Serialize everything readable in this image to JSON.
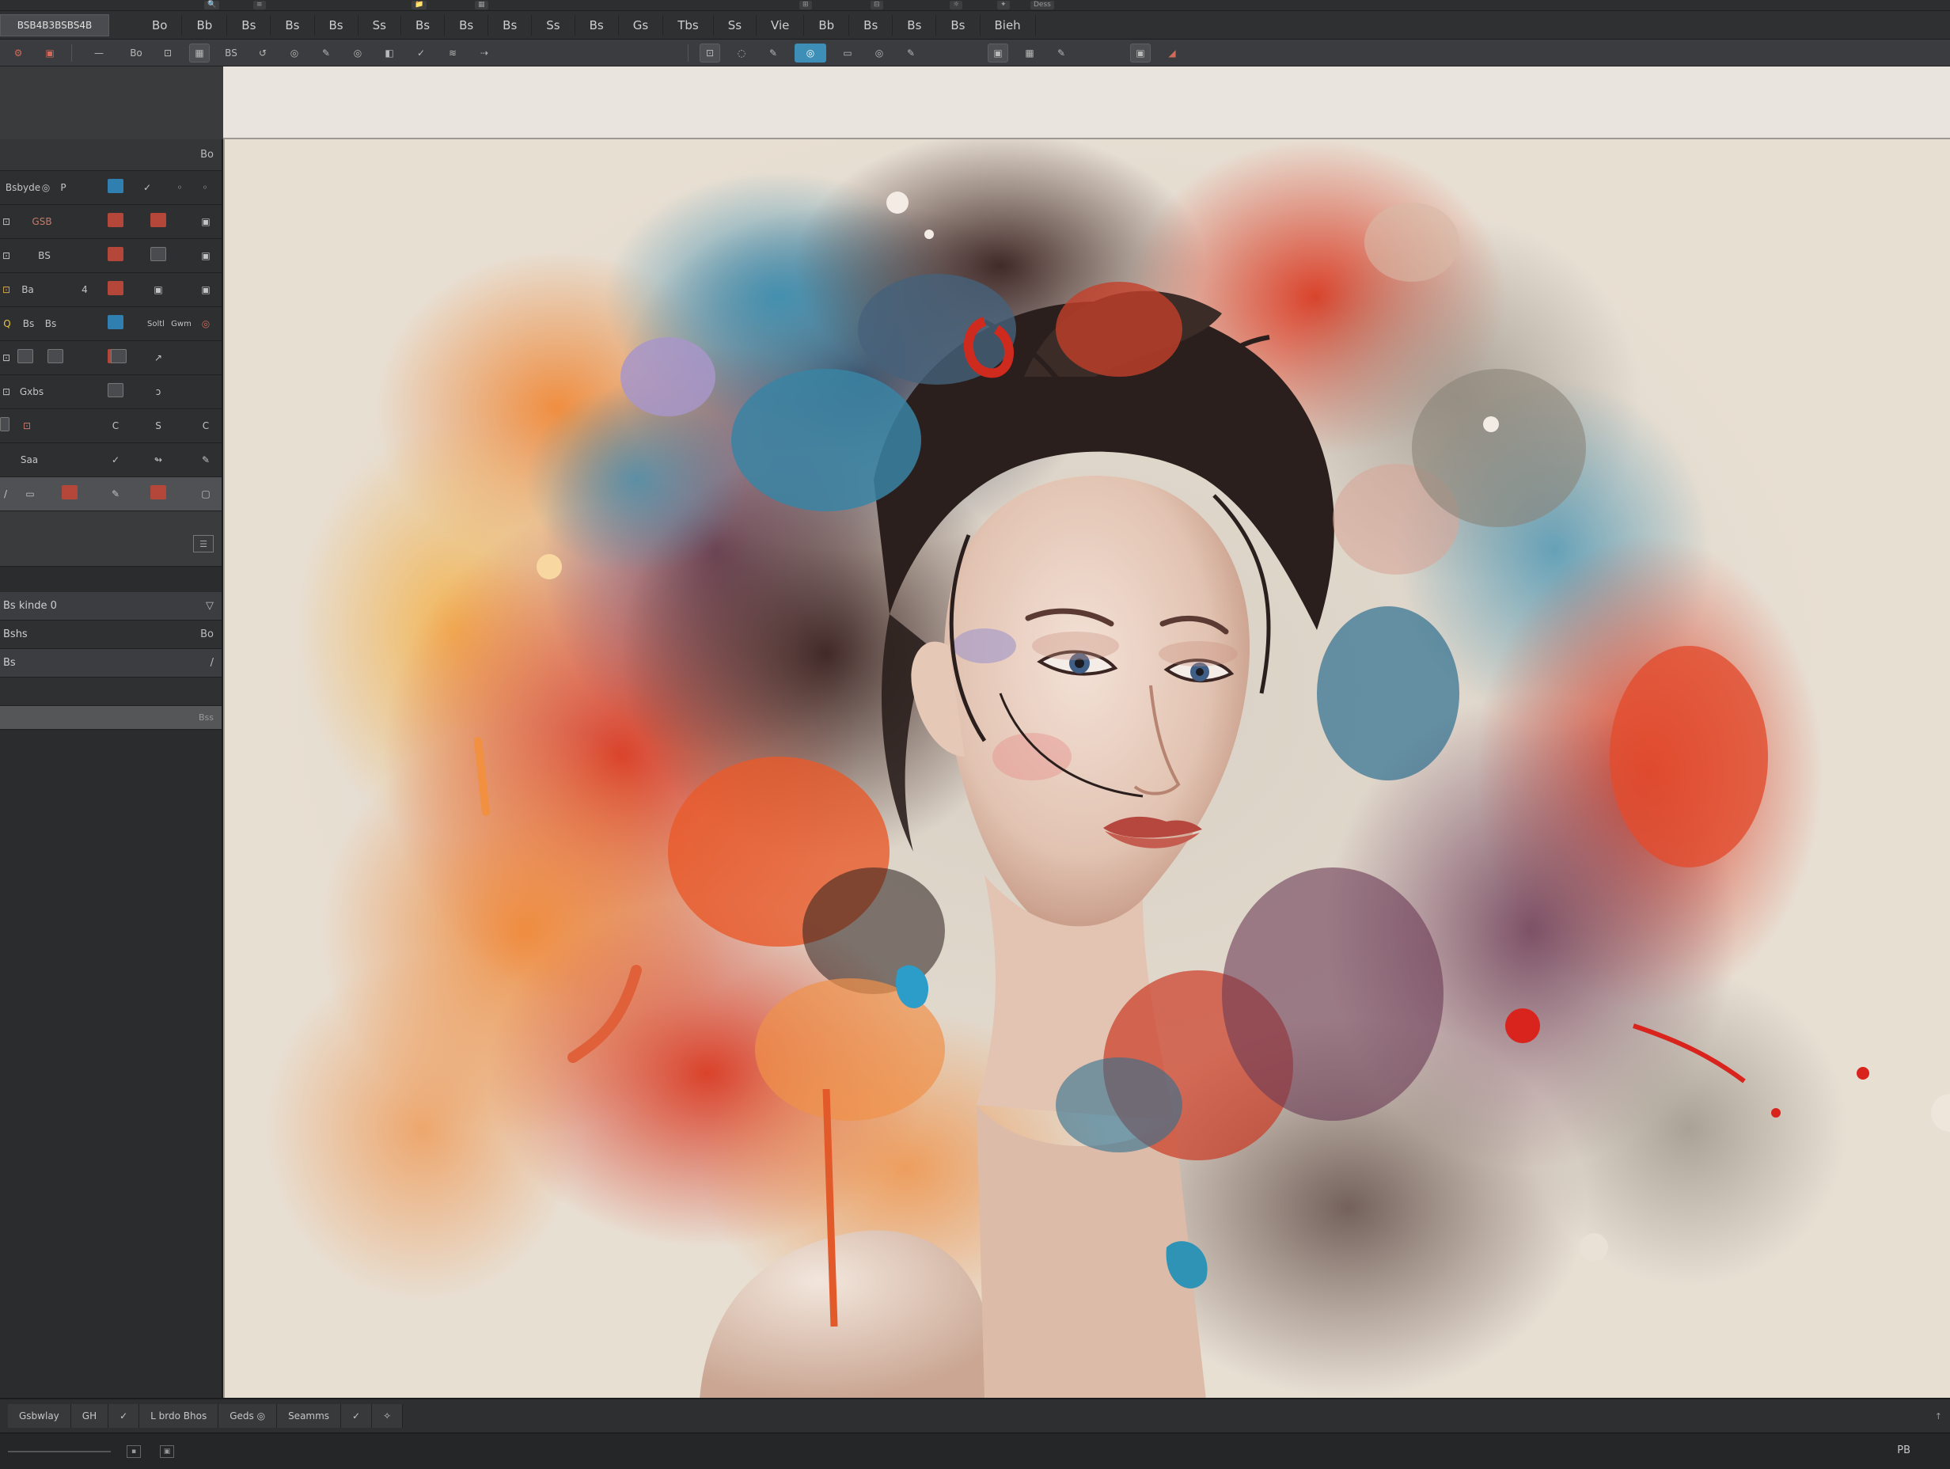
{
  "window": {
    "top_strip": [
      "🔍",
      "≡",
      "📁",
      "▦",
      "⊞",
      "⊟",
      "☼",
      "✦",
      "Dess"
    ],
    "doc_tab": "BSB4B3BSBS4B"
  },
  "menubar": {
    "items": [
      "Bo",
      "Bb",
      "Bs",
      "Bs",
      "Bs",
      "Ss",
      "Bs",
      "Bs",
      "Bs",
      "Ss",
      "Bs",
      "Gs",
      "Tbs",
      "Ss",
      "Vie",
      "Bb",
      "Bs",
      "Bs",
      "Bs",
      "Bieh"
    ]
  },
  "options": {
    "items": [
      "⚙",
      "▣",
      "—",
      "Bo",
      "⊡",
      "▦",
      "BS",
      "↺",
      "◎",
      "✎",
      "◎",
      "◧",
      "✓",
      "≋",
      "⇢",
      "⊡",
      "◌",
      "✎",
      "◎",
      "▭",
      "◎",
      "✎",
      "▣",
      "▦",
      "✎",
      "▣",
      "◢"
    ]
  },
  "panel": {
    "header": "Bo",
    "rows": [
      {
        "label": "Bsbyde",
        "c2": "◎",
        "c3": "P",
        "c5": "✓",
        "c6": "◦",
        "c7": "◦"
      },
      {
        "label": "⊡",
        "c2": "GSB",
        "c3": "▣",
        "c5": "▣",
        "c7": "▣"
      },
      {
        "label": "⊡",
        "c2": "BS",
        "c3": "▣",
        "c5": "▣",
        "c7": "▣"
      },
      {
        "label": "Ba",
        "c2": "⊡",
        "c3": "4",
        "c5": "▣",
        "c7": "▣"
      },
      {
        "label": "Q",
        "c2": "Bs",
        "c3": "Bs",
        "c5": "Soltl",
        "c6": "Gwm",
        "c7": "◎"
      },
      {
        "label": "⊡",
        "c2": "⊡",
        "c3": "▣",
        "c5": "▣",
        "c7": "↗"
      },
      {
        "label": "Gxbs",
        "c2": "",
        "c3": "",
        "c5": "▣",
        "c7": "ↄ"
      },
      {
        "label": "⊡",
        "c2": "⊡",
        "c3": "C",
        "c5": "S",
        "c7": "C"
      },
      {
        "label": "Saa",
        "c2": "",
        "c3": "",
        "c5": "✓",
        "c6": "↬",
        "c7": "✎"
      },
      {
        "label": "/",
        "c2": "▭",
        "c3": "▣",
        "c5": "✎",
        "c6": "▣",
        "c7": "▢"
      }
    ],
    "layers": [
      {
        "label": "Bs kinde  0",
        "right": "▽"
      },
      {
        "label": "Bshs",
        "right": "Bo"
      },
      {
        "label": "Bs",
        "right": "/"
      },
      {
        "label": "",
        "right": ""
      }
    ],
    "slider_label": "Bss"
  },
  "statusbar": {
    "items": [
      "Gsbwlay",
      "GH",
      "✓",
      "L brdo Bhos",
      "Geds ◎",
      "Seamms",
      "✓",
      "✧"
    ]
  },
  "bottombar": {
    "icons": [
      "▪",
      "▣"
    ],
    "right": "PB",
    "corner": "↑"
  },
  "colors": {
    "accent": "#3e8fb8",
    "panel_swatch_red": "#b5473a",
    "panel_swatch_blue": "#2f7fb0",
    "canvas_bg": "#e8dfd3"
  }
}
